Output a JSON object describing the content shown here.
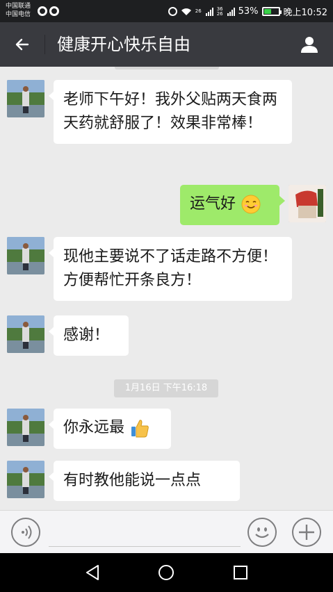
{
  "statusbar": {
    "carrier1": "中国联通",
    "carrier2": "中国电信",
    "sig1_label": "26",
    "sig2_label": "36",
    "sig2_label2": "26",
    "battery": "53%",
    "battery_level": 0.53,
    "time": "晚上10:52"
  },
  "header": {
    "title": "健康开心快乐自由",
    "back_icon": "arrow-left-icon",
    "profile_icon": "person-icon"
  },
  "messages": [
    {
      "side": "left",
      "text": "老师下午好！我外父贴两天食两天药就舒服了！效果非常棒！"
    },
    {
      "side": "right",
      "text": "运气好",
      "emoji": "smiling-face-emoji"
    },
    {
      "side": "left",
      "text": "现他主要说不了话走路不方便！方便帮忙开条良方！"
    },
    {
      "side": "left",
      "text": "感谢！"
    },
    {
      "type": "timestamp",
      "text": "1月16日 下午16:18"
    },
    {
      "side": "left",
      "text": "你永远最",
      "emoji": "thumbs-up-emoji"
    },
    {
      "side": "left",
      "text": "有时教他能说一点点"
    }
  ],
  "inputbar": {
    "voice_icon": "voice-icon",
    "emoji_icon": "smiley-icon",
    "plus_icon": "plus-icon"
  },
  "navbar": {
    "back_icon": "triangle-back-icon",
    "home_icon": "circle-home-icon",
    "recents_icon": "square-recents-icon"
  },
  "colors": {
    "titlebar": "#393a3f",
    "statusbar": "#1e1f21",
    "chat_bg": "#ebebeb",
    "bubble_self": "#9eea6a",
    "bubble_other": "#ffffff"
  }
}
